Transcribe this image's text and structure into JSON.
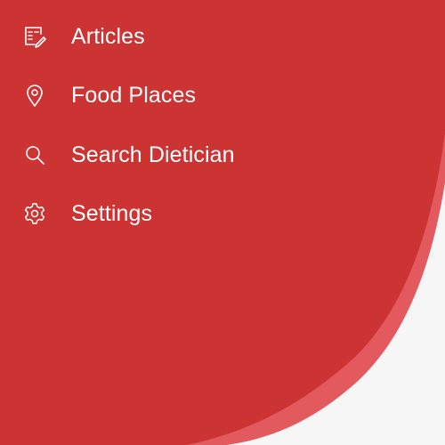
{
  "colors": {
    "primary_red": "#cc3333",
    "secondary_red": "#e2595e",
    "background": "#f6f6f6",
    "text": "#ffffff"
  },
  "menu": {
    "items": [
      {
        "label": "Articles",
        "icon": "article-edit-icon"
      },
      {
        "label": "Food Places",
        "icon": "location-pin-icon"
      },
      {
        "label": "Search Dietician",
        "icon": "search-icon"
      },
      {
        "label": "Settings",
        "icon": "gear-icon"
      }
    ]
  }
}
